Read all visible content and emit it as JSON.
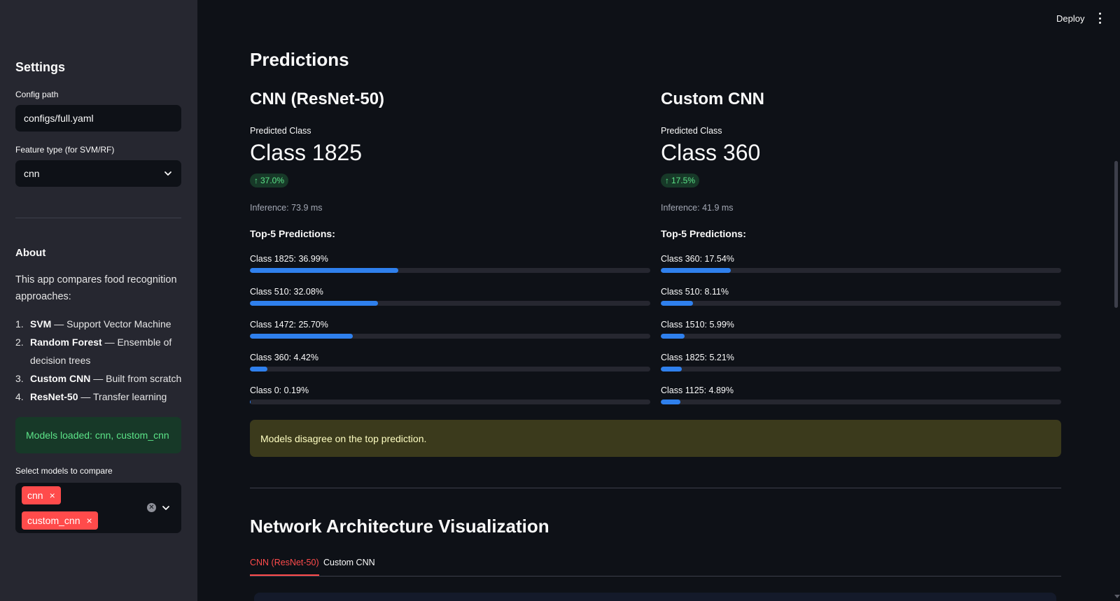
{
  "topbar": {
    "deploy_label": "Deploy"
  },
  "sidebar": {
    "title": "Settings",
    "config_path": {
      "label": "Config path",
      "value": "configs/full.yaml"
    },
    "feature_type": {
      "label": "Feature type (for SVM/RF)",
      "value": "cnn"
    },
    "about": {
      "title": "About",
      "description": "This app compares food recognition approaches:",
      "items": [
        {
          "num": "1.",
          "name": "SVM",
          "desc": " — Support Vector Machine"
        },
        {
          "num": "2.",
          "name": "Random Forest",
          "desc": " — Ensemble of decision trees"
        },
        {
          "num": "3.",
          "name": "Custom CNN",
          "desc": " — Built from scratch"
        },
        {
          "num": "4.",
          "name": "ResNet-50",
          "desc": " — Transfer learning"
        }
      ]
    },
    "status": "Models loaded: cnn, custom_cnn",
    "compare": {
      "label": "Select models to compare",
      "tags": [
        "cnn",
        "custom_cnn"
      ]
    }
  },
  "main": {
    "title": "Predictions",
    "columns": [
      {
        "title": "CNN (ResNet-50)",
        "predicted_label": "Predicted Class",
        "predicted_value": "Class 1825",
        "delta": "37.0%",
        "inference": "Inference: 73.9 ms",
        "top5_title": "Top-5 Predictions:",
        "predictions": [
          {
            "label": "Class 1825: 36.99%",
            "progress": 0.3699
          },
          {
            "label": "Class 510: 32.08%",
            "progress": 0.3208
          },
          {
            "label": "Class 1472: 25.70%",
            "progress": 0.257
          },
          {
            "label": "Class 360: 4.42%",
            "progress": 0.0442
          },
          {
            "label": "Class 0: 0.19%",
            "progress": 0.0019
          }
        ]
      },
      {
        "title": "Custom CNN",
        "predicted_label": "Predicted Class",
        "predicted_value": "Class 360",
        "delta": "17.5%",
        "inference": "Inference: 41.9 ms",
        "top5_title": "Top-5 Predictions:",
        "predictions": [
          {
            "label": "Class 360: 17.54%",
            "progress": 0.1754
          },
          {
            "label": "Class 510: 8.11%",
            "progress": 0.0811
          },
          {
            "label": "Class 1510: 5.99%",
            "progress": 0.0599
          },
          {
            "label": "Class 1825: 5.21%",
            "progress": 0.0521
          },
          {
            "label": "Class 1125: 4.89%",
            "progress": 0.0489
          }
        ]
      }
    ],
    "warning": "Models disagree on the top prediction.",
    "section_title": "Network Architecture Visualization",
    "tabs": [
      {
        "label": "CNN (ResNet-50)",
        "active": true
      },
      {
        "label": "Custom CNN",
        "active": false
      }
    ]
  },
  "colors": {
    "accent": "#ff4b4b",
    "progress": "#2f80ed",
    "success": "#5ce488",
    "background": "#0e1117",
    "sidebar": "#262730"
  }
}
